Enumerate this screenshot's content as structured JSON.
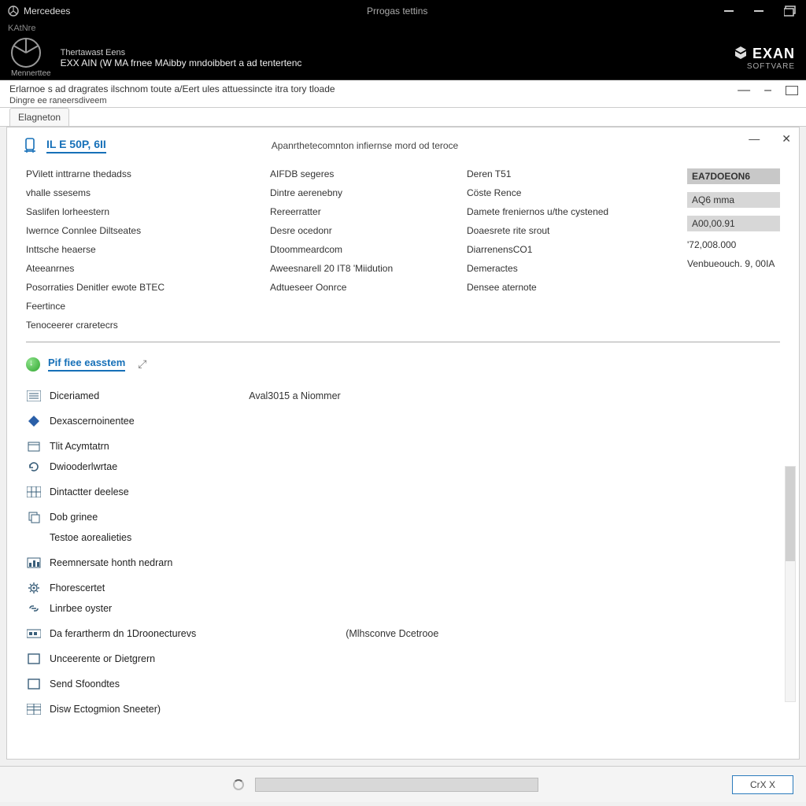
{
  "titlebar": {
    "app_name": "Mercedees",
    "center_text": "Prrogas tettins",
    "sub_line": "KAtNre"
  },
  "vehicle": {
    "brand_caption": "Mennerttee",
    "line1": "Thertawast Eens",
    "line2": "EXX AIN (W MA frnee MAibby mndoibbert a ad tentertenc"
  },
  "brand": {
    "name": "EXAN",
    "sub": "SOFTVARE"
  },
  "breadcrumb": {
    "path": "Erlarnoe s ad dragrates ilschnom toute a/Eert ules attuessincte itra tory tloade",
    "line2": "Dingre ee raneersdiveem"
  },
  "tab": {
    "label": "Elagneton"
  },
  "panel": {
    "minimize": "—",
    "close": "✕"
  },
  "ecu": {
    "title": "IL E 50P, 6II",
    "subtitle": "Apanrthetecomnton infiernse mord od teroce"
  },
  "info": {
    "col1": [
      "PVilett inttrarne thedadss",
      "vhalle ssesems",
      "Saslifen lorheestern",
      "Iwernce Connlee Diltseates",
      "Inttsche heaerse",
      "Ateeanrnes",
      "Posorraties Denitler ewote BTEC",
      "Feertince",
      "Tenoceerer craretecrs"
    ],
    "col2": [
      "AIFDB segeres",
      "Dintre aerenebny",
      "Rereerratter",
      "Desre ocedonr",
      "Dtoommeardcom",
      "Aweesnarell 20 IT8 'Miidution",
      "Adtueseer Oonrce"
    ],
    "col3": [
      "Deren T51",
      "Cöste Rence",
      "Damete freniernos u/the cystened",
      "Doaesrete rite srout",
      "DiarrenensCO1",
      "Demeractes",
      "Densee aternote"
    ],
    "col4": [
      "EA7DOEON6",
      "AQ6 mma",
      "A00,00.91",
      "'72,008.000",
      "Venbueouch. 9, 00IA"
    ]
  },
  "section": {
    "title": "Pif fiee easstem",
    "expand": "⤢"
  },
  "tree": [
    {
      "icon": "list",
      "label": "Diceriamed",
      "extra": "Aval3015 a Niommer"
    },
    {
      "icon": "diamond",
      "label": "Dexascernoinentee"
    },
    {
      "icon": "calendar",
      "label": "Tlit Acymtatrn"
    },
    {
      "icon": "refresh",
      "label": "Dwiooderlwrtae",
      "sub": true
    },
    {
      "icon": "grid",
      "label": "Dintactter deelese"
    },
    {
      "icon": "stack",
      "label": "Dob grinee"
    },
    {
      "icon": "blank",
      "label": "Testoe aorealieties",
      "sub": true
    },
    {
      "icon": "bars",
      "label": "Reemnersate honth nedrarn"
    },
    {
      "icon": "gear",
      "label": "Fhorescertet"
    },
    {
      "icon": "link",
      "label": "Linrbee oyster",
      "sub": true
    },
    {
      "icon": "module",
      "label": "Da ferartherm dn 1Droonecturevs",
      "extra": "(Mlhsconve Dcetrooe"
    },
    {
      "icon": "box",
      "label": "Unceerente or Dietgrern"
    },
    {
      "icon": "box",
      "label": "Send Sfoondtes"
    },
    {
      "icon": "grid2",
      "label": "Disw Ectogmion Sneeter)"
    }
  ],
  "footer": {
    "ok": "CrX X"
  }
}
